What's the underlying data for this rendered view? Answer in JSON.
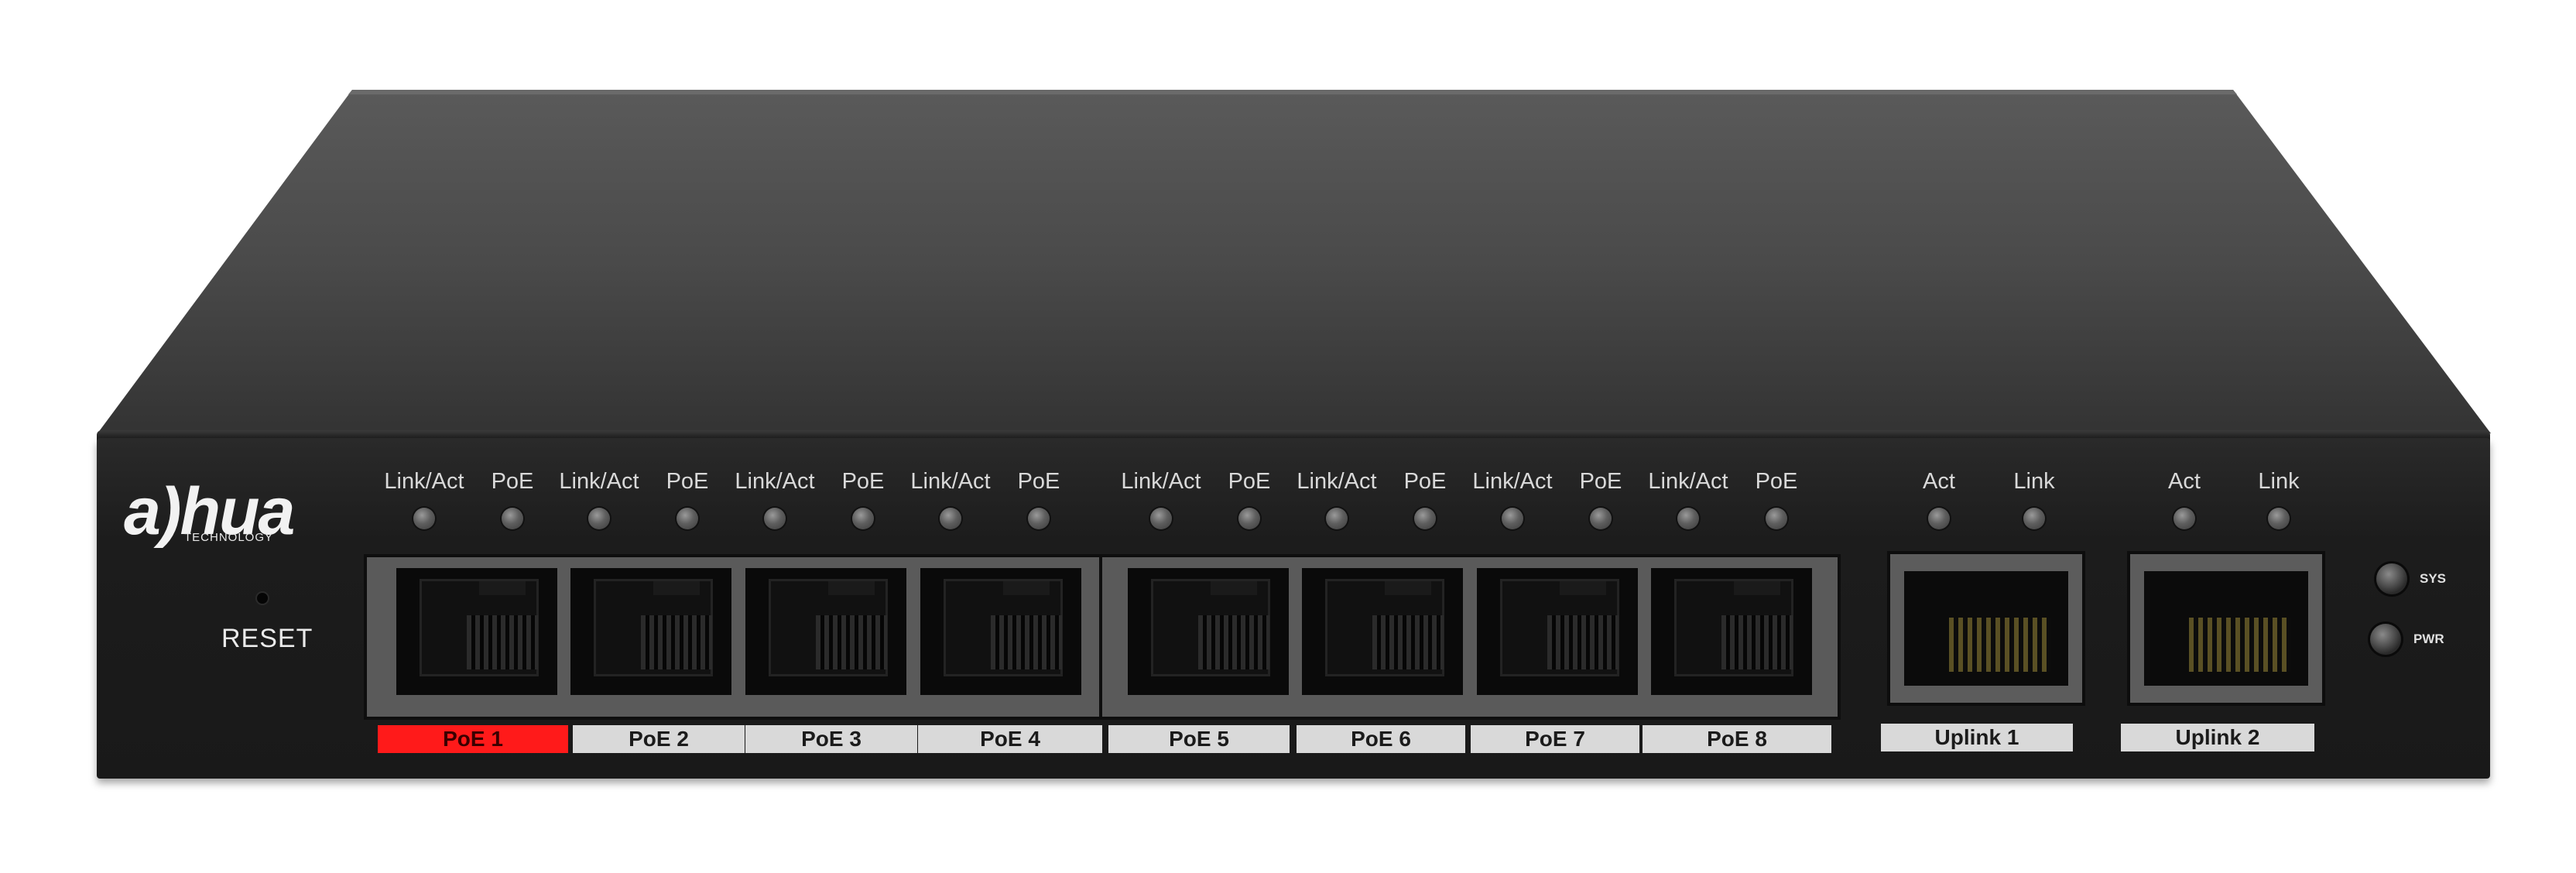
{
  "brand": {
    "name": "a)hua",
    "tagline": "TECHNOLOGY"
  },
  "reset": {
    "label": "RESET"
  },
  "poe_ports": [
    {
      "led_labels": [
        "Link/Act",
        "PoE"
      ],
      "label": "PoE 1",
      "highlighted": true
    },
    {
      "led_labels": [
        "Link/Act",
        "PoE"
      ],
      "label": "PoE 2",
      "highlighted": false
    },
    {
      "led_labels": [
        "Link/Act",
        "PoE"
      ],
      "label": "PoE 3",
      "highlighted": false
    },
    {
      "led_labels": [
        "Link/Act",
        "PoE"
      ],
      "label": "PoE 4",
      "highlighted": false
    },
    {
      "led_labels": [
        "Link/Act",
        "PoE"
      ],
      "label": "PoE 5",
      "highlighted": false
    },
    {
      "led_labels": [
        "Link/Act",
        "PoE"
      ],
      "label": "PoE 6",
      "highlighted": false
    },
    {
      "led_labels": [
        "Link/Act",
        "PoE"
      ],
      "label": "PoE 7",
      "highlighted": false
    },
    {
      "led_labels": [
        "Link/Act",
        "PoE"
      ],
      "label": "PoE 8",
      "highlighted": false
    }
  ],
  "uplink_ports": [
    {
      "led_labels": [
        "Act",
        "Link"
      ],
      "label": "Uplink 1"
    },
    {
      "led_labels": [
        "Act",
        "Link"
      ],
      "label": "Uplink 2"
    }
  ],
  "status_leds": [
    {
      "label": "SYS"
    },
    {
      "label": "PWR"
    }
  ],
  "colors": {
    "highlight": "#ff1a1a",
    "body": "#1c1c1c",
    "label_strip": "#d9d9d9"
  }
}
